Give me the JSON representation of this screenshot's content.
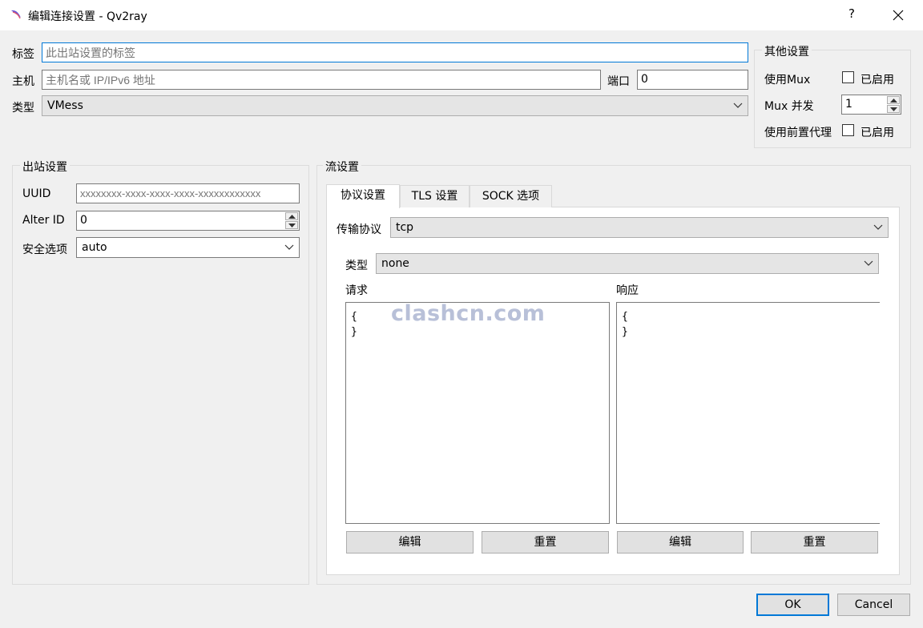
{
  "window": {
    "title": "编辑连接设置 - Qv2ray",
    "help_label": "?",
    "close_label": "✕"
  },
  "main": {
    "tag_label": "标签",
    "tag_placeholder": "此出站设置的标签",
    "host_label": "主机",
    "host_placeholder": "主机名或 IP/IPv6 地址",
    "port_label": "端口",
    "port_value": "0",
    "type_label": "类型",
    "type_value": "VMess"
  },
  "other": {
    "title": "其他设置",
    "use_mux_label": "使用Mux",
    "mux_enabled_label": "已启用",
    "mux_concurrency_label": "Mux 并发",
    "mux_concurrency_value": "1",
    "front_proxy_label": "使用前置代理",
    "front_proxy_enabled_label": "已启用",
    "mux_checked": false,
    "front_proxy_checked": false
  },
  "outbound": {
    "title": "出站设置",
    "uuid_label": "UUID",
    "uuid_placeholder": "xxxxxxxx-xxxx-xxxx-xxxx-xxxxxxxxxxxx",
    "alterid_label": "Alter ID",
    "alterid_value": "0",
    "security_label": "安全选项",
    "security_value": "auto"
  },
  "stream": {
    "title": "流设置",
    "tabs": [
      {
        "label": "协议设置",
        "active": true
      },
      {
        "label": "TLS 设置",
        "active": false
      },
      {
        "label": "SOCK 选项",
        "active": false
      }
    ],
    "transport_label": "传输协议",
    "transport_value": "tcp",
    "header_type_label": "类型",
    "header_type_value": "none",
    "request_label": "请求",
    "request_text": "{\n}",
    "response_label": "响应",
    "response_text": "{\n}",
    "request_edit_label": "编辑",
    "request_reset_label": "重置",
    "response_edit_label": "编辑",
    "response_reset_label": "重置"
  },
  "watermark": "clashcn.com",
  "footer": {
    "ok_label": "OK",
    "cancel_label": "Cancel"
  },
  "colors": {
    "accent": "#0078d7",
    "window_bg": "#f0f0f0"
  }
}
